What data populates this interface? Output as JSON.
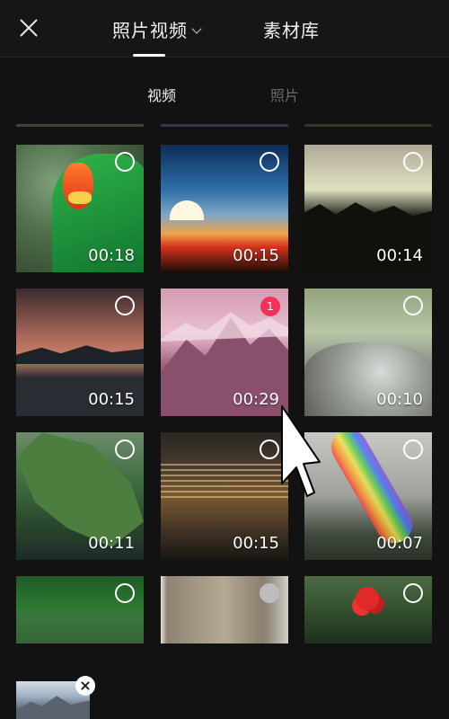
{
  "header": {
    "tabs": [
      {
        "label": "照片视频"
      },
      {
        "label": "素材库"
      }
    ]
  },
  "subtabs": [
    {
      "label": "视频"
    },
    {
      "label": "照片"
    }
  ],
  "grid": {
    "tiles": [
      {
        "duration": "00:18",
        "subject": "parrot"
      },
      {
        "duration": "00:15",
        "subject": "sunset"
      },
      {
        "duration": "00:14",
        "subject": "dusk trees"
      },
      {
        "duration": "00:15",
        "subject": "dusk lake"
      },
      {
        "duration": "00:29",
        "subject": "mountains",
        "selected_index": "1"
      },
      {
        "duration": "00:10",
        "subject": "stream rocks"
      },
      {
        "duration": "00:11",
        "subject": "island"
      },
      {
        "duration": "00:15",
        "subject": "water"
      },
      {
        "duration": "00:07",
        "subject": "rainbow"
      },
      {
        "subject": "forest"
      },
      {
        "subject": "tree trunk"
      },
      {
        "subject": "berries"
      }
    ]
  },
  "selection_tray": {
    "items": [
      {
        "subject": "mountains"
      }
    ]
  },
  "colors": {
    "background": "#121212",
    "accent_badge": "#f2325a"
  },
  "icons": [
    "close-icon",
    "chevron-down-icon",
    "remove-icon",
    "mouse-pointer-icon"
  ]
}
